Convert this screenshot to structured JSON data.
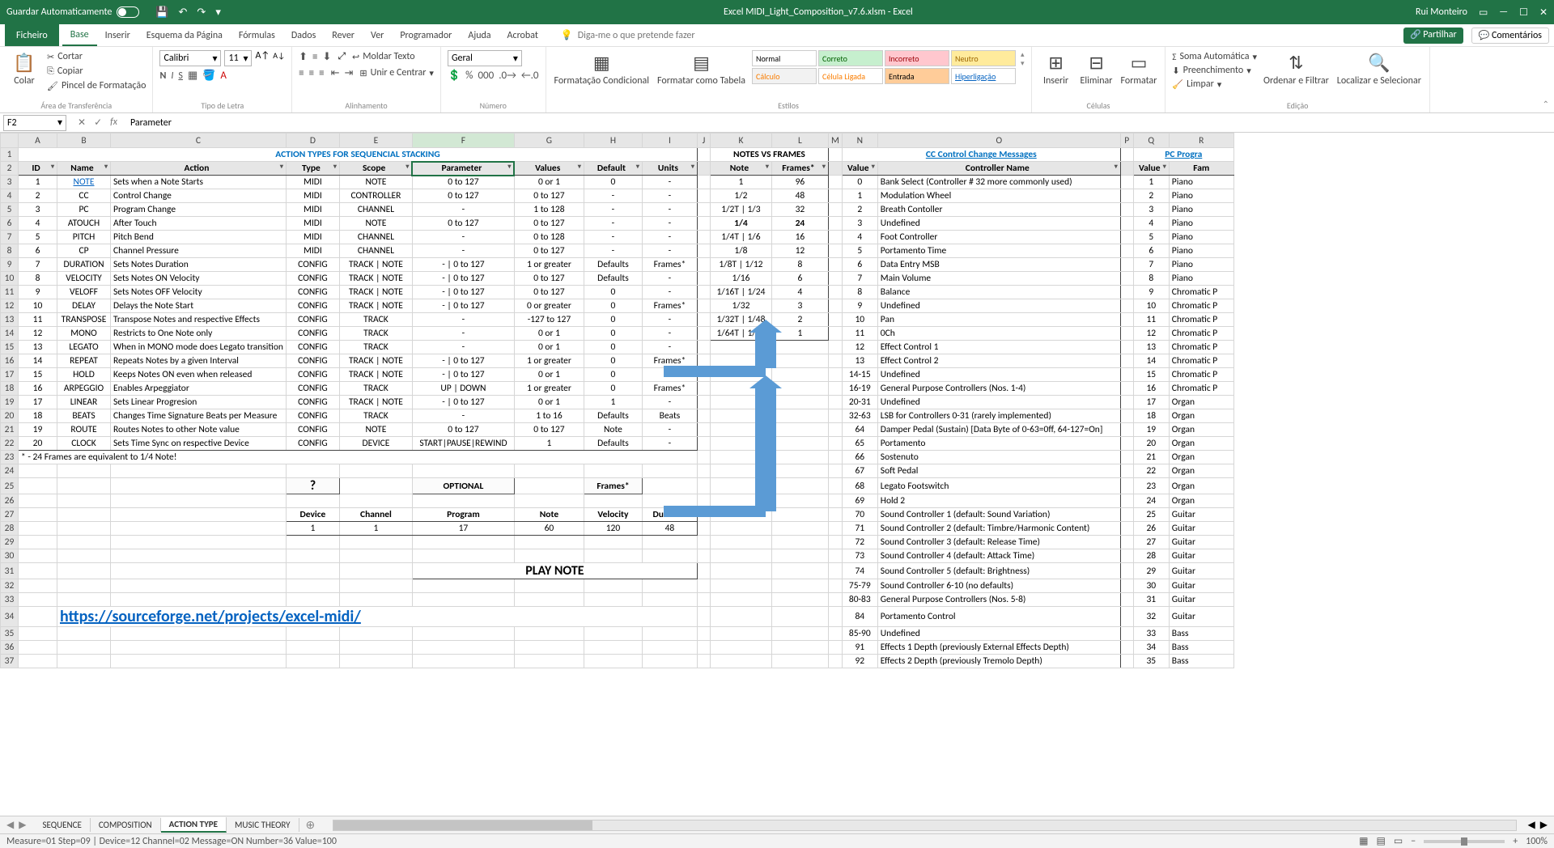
{
  "title": "Excel MIDI_Light_Composition_v7.6.xlsm - Excel",
  "user": "Rui Monteiro",
  "autosave_label": "Guardar Automaticamente",
  "tabs": {
    "file": "Ficheiro",
    "home": "Base",
    "insert": "Inserir",
    "layout": "Esquema da Página",
    "formulas": "Fórmulas",
    "data": "Dados",
    "review": "Rever",
    "view": "Ver",
    "developer": "Programador",
    "help": "Ajuda",
    "acrobat": "Acrobat"
  },
  "tellme": "Diga-me o que pretende fazer",
  "share": "Partilhar",
  "comments": "Comentários",
  "ribbon": {
    "clipboard": {
      "paste": "Colar",
      "cut": "Cortar",
      "copy": "Copiar",
      "format_painter": "Pincel de Formatação",
      "label": "Área de Transferência"
    },
    "font": {
      "name": "Calibri",
      "size": "11",
      "label": "Tipo de Letra"
    },
    "alignment": {
      "wrap": "Moldar Texto",
      "merge": "Unir e Centrar",
      "label": "Alinhamento"
    },
    "number": {
      "format": "Geral",
      "label": "Número"
    },
    "styles": {
      "normal": "Normal",
      "good": "Correto",
      "bad": "Incorreto",
      "neutral": "Neutro",
      "calc": "Cálculo",
      "linked": "Célula Ligada",
      "input": "Entrada",
      "hyper": "Hiperligação",
      "cond": "Formatação Condicional",
      "tablefmt": "Formatar como Tabela",
      "label": "Estilos"
    },
    "cells": {
      "insert": "Inserir",
      "delete": "Eliminar",
      "format": "Formatar",
      "label": "Células"
    },
    "editing": {
      "autosum": "Soma Automática",
      "fill": "Preenchimento",
      "clear": "Limpar",
      "sort": "Ordenar e Filtrar",
      "find": "Localizar e Selecionar",
      "label": "Edição"
    }
  },
  "namebox": "F2",
  "formula": "Parameter",
  "cols": [
    "A",
    "B",
    "C",
    "D",
    "E",
    "F",
    "G",
    "H",
    "I",
    "J",
    "K",
    "L",
    "M",
    "N",
    "O",
    "P",
    "Q",
    "R"
  ],
  "titles": {
    "actions": "ACTION TYPES FOR SEQUENCIAL STACKING",
    "notes": "NOTES VS FRAMES",
    "cc": "CC Control Change Messages",
    "pc": "PC Progra"
  },
  "headers": {
    "id": "ID",
    "name": "Name",
    "action": "Action",
    "type": "Type",
    "scope": "Scope",
    "parameter": "Parameter",
    "values": "Values",
    "default": "Default",
    "units": "Units",
    "note": "Note",
    "frames": "Frames*",
    "value": "Value",
    "ctrlname": "Controller Name",
    "value2": "Value",
    "family": "Fam"
  },
  "actions": [
    {
      "id": "1",
      "name": "NOTE",
      "action": "Sets when a Note Starts",
      "type": "MIDI",
      "scope": "NOTE",
      "param": "0 to 127",
      "values": "0 or 1",
      "def": "0",
      "units": "-"
    },
    {
      "id": "2",
      "name": "CC",
      "action": "Control Change",
      "type": "MIDI",
      "scope": "CONTROLLER",
      "param": "0 to 127",
      "values": "0 to 127",
      "def": "-",
      "units": "-"
    },
    {
      "id": "3",
      "name": "PC",
      "action": "Program Change",
      "type": "MIDI",
      "scope": "CHANNEL",
      "param": "-",
      "values": "1 to 128",
      "def": "-",
      "units": "-"
    },
    {
      "id": "4",
      "name": "ATOUCH",
      "action": "After Touch",
      "type": "MIDI",
      "scope": "NOTE",
      "param": "0 to 127",
      "values": "0 to 127",
      "def": "-",
      "units": "-"
    },
    {
      "id": "5",
      "name": "PITCH",
      "action": "Pitch Bend",
      "type": "MIDI",
      "scope": "CHANNEL",
      "param": "-",
      "values": "0 to 128",
      "def": "-",
      "units": "-"
    },
    {
      "id": "6",
      "name": "CP",
      "action": "Channel Pressure",
      "type": "MIDI",
      "scope": "CHANNEL",
      "param": "-",
      "values": "0 to 127",
      "def": "-",
      "units": "-"
    },
    {
      "id": "7",
      "name": "DURATION",
      "action": "Sets Notes Duration",
      "type": "CONFIG",
      "scope": "TRACK | NOTE",
      "param": "- | 0 to 127",
      "values": "1 or greater",
      "def": "Defaults",
      "units": "Frames*"
    },
    {
      "id": "8",
      "name": "VELOCITY",
      "action": "Sets Notes ON Velocity",
      "type": "CONFIG",
      "scope": "TRACK | NOTE",
      "param": "- | 0 to 127",
      "values": "0 to 127",
      "def": "Defaults",
      "units": "-"
    },
    {
      "id": "9",
      "name": "VELOFF",
      "action": "Sets Notes OFF Velocity",
      "type": "CONFIG",
      "scope": "TRACK | NOTE",
      "param": "- | 0 to 127",
      "values": "0 to 127",
      "def": "0",
      "units": "-"
    },
    {
      "id": "10",
      "name": "DELAY",
      "action": "Delays the Note Start",
      "type": "CONFIG",
      "scope": "TRACK | NOTE",
      "param": "- | 0 to 127",
      "values": "0 or greater",
      "def": "0",
      "units": "Frames*"
    },
    {
      "id": "11",
      "name": "TRANSPOSE",
      "action": "Transpose Notes and respective Effects",
      "type": "CONFIG",
      "scope": "TRACK",
      "param": "-",
      "values": "-127 to 127",
      "def": "0",
      "units": "-"
    },
    {
      "id": "12",
      "name": "MONO",
      "action": "Restricts to One Note only",
      "type": "CONFIG",
      "scope": "TRACK",
      "param": "-",
      "values": "0 or 1",
      "def": "0",
      "units": "-"
    },
    {
      "id": "13",
      "name": "LEGATO",
      "action": "When in MONO mode does Legato transition",
      "type": "CONFIG",
      "scope": "TRACK",
      "param": "-",
      "values": "0 or 1",
      "def": "0",
      "units": "-"
    },
    {
      "id": "14",
      "name": "REPEAT",
      "action": "Repeats Notes by a given Interval",
      "type": "CONFIG",
      "scope": "TRACK | NOTE",
      "param": "- | 0 to 127",
      "values": "1 or greater",
      "def": "0",
      "units": "Frames*"
    },
    {
      "id": "15",
      "name": "HOLD",
      "action": "Keeps Notes ON even when released",
      "type": "CONFIG",
      "scope": "TRACK | NOTE",
      "param": "- | 0 to 127",
      "values": "0 or 1",
      "def": "0",
      "units": "-"
    },
    {
      "id": "16",
      "name": "ARPEGGIO",
      "action": "Enables Arpeggiator",
      "type": "CONFIG",
      "scope": "TRACK",
      "param": "UP | DOWN",
      "values": "1 or greater",
      "def": "0",
      "units": "Frames*"
    },
    {
      "id": "17",
      "name": "LINEAR",
      "action": "Sets Linear Progresion",
      "type": "CONFIG",
      "scope": "TRACK | NOTE",
      "param": "- | 0 to 127",
      "values": "0 or 1",
      "def": "1",
      "units": "-"
    },
    {
      "id": "18",
      "name": "BEATS",
      "action": "Changes Time Signature Beats per Measure",
      "type": "CONFIG",
      "scope": "TRACK",
      "param": "-",
      "values": "1 to 16",
      "def": "Defaults",
      "units": "Beats"
    },
    {
      "id": "19",
      "name": "ROUTE",
      "action": "Routes Notes to other Note value",
      "type": "CONFIG",
      "scope": "NOTE",
      "param": "0 to 127",
      "values": "0 to 127",
      "def": "Note",
      "units": "-"
    },
    {
      "id": "20",
      "name": "CLOCK",
      "action": "Sets Time Sync on respective Device",
      "type": "CONFIG",
      "scope": "DEVICE",
      "param": "START|PAUSE|REWIND",
      "values": "1",
      "def": "Defaults",
      "units": "-"
    }
  ],
  "footnote": "* - 24 Frames are equivalent to 1/4 Note!",
  "notes_frames": [
    {
      "n": "1",
      "f": "96"
    },
    {
      "n": "1/2",
      "f": "48"
    },
    {
      "n": "1/2T | 1/3",
      "f": "32"
    },
    {
      "n": "1/4",
      "f": "24"
    },
    {
      "n": "1/4T | 1/6",
      "f": "16"
    },
    {
      "n": "1/8",
      "f": "12"
    },
    {
      "n": "1/8T | 1/12",
      "f": "8"
    },
    {
      "n": "1/16",
      "f": "6"
    },
    {
      "n": "1/16T | 1/24",
      "f": "4"
    },
    {
      "n": "1/32",
      "f": "3"
    },
    {
      "n": "1/32T | 1/48",
      "f": "2"
    },
    {
      "n": "1/64T | 1/96",
      "f": "1"
    }
  ],
  "cc": [
    {
      "v": "0",
      "n": "Bank Select (Controller # 32 more commonly used)"
    },
    {
      "v": "1",
      "n": "Modulation Wheel"
    },
    {
      "v": "2",
      "n": "Breath Contoller"
    },
    {
      "v": "3",
      "n": "Undefined"
    },
    {
      "v": "4",
      "n": "Foot Controller"
    },
    {
      "v": "5",
      "n": "Portamento Time"
    },
    {
      "v": "6",
      "n": "Data Entry MSB"
    },
    {
      "v": "7",
      "n": "Main Volume"
    },
    {
      "v": "8",
      "n": "Balance"
    },
    {
      "v": "9",
      "n": "Undefined"
    },
    {
      "v": "10",
      "n": "Pan"
    },
    {
      "v": "11",
      "n": "0Ch"
    },
    {
      "v": "12",
      "n": "Effect Control 1"
    },
    {
      "v": "13",
      "n": "Effect Control 2"
    },
    {
      "v": "14-15",
      "n": "Undefined"
    },
    {
      "v": "16-19",
      "n": "General Purpose Controllers (Nos. 1-4)"
    },
    {
      "v": "20-31",
      "n": "Undefined"
    },
    {
      "v": "32-63",
      "n": "LSB for Controllers 0-31 (rarely implemented)"
    },
    {
      "v": "64",
      "n": "Damper Pedal (Sustain) [Data Byte of 0-63=0ff, 64-127=On]"
    },
    {
      "v": "65",
      "n": "Portamento"
    },
    {
      "v": "66",
      "n": "Sostenuto"
    },
    {
      "v": "67",
      "n": "Soft Pedal"
    },
    {
      "v": "68",
      "n": "Legato Footswitch"
    },
    {
      "v": "69",
      "n": "Hold 2"
    },
    {
      "v": "70",
      "n": "Sound Controller 1 (default: Sound Variation)"
    },
    {
      "v": "71",
      "n": "Sound Controller 2 (default: Timbre/Harmonic Content)"
    },
    {
      "v": "72",
      "n": "Sound Controller 3 (default: Release Time)"
    },
    {
      "v": "73",
      "n": "Sound Controller 4 (default: Attack Time)"
    },
    {
      "v": "74",
      "n": "Sound Controller 5 (default: Brightness)"
    },
    {
      "v": "75-79",
      "n": "Sound Controller 6-10 (no defaults)"
    },
    {
      "v": "80-83",
      "n": "General Purpose Controllers (Nos. 5-8)"
    },
    {
      "v": "84",
      "n": "Portamento Control"
    },
    {
      "v": "85-90",
      "n": "Undefined"
    },
    {
      "v": "91",
      "n": "Effects 1 Depth (previously External Effects Depth)"
    },
    {
      "v": "92",
      "n": "Effects 2 Depth (previously Tremolo Depth)"
    }
  ],
  "pc": [
    {
      "v": "1",
      "fam": "Piano"
    },
    {
      "v": "2",
      "fam": "Piano"
    },
    {
      "v": "3",
      "fam": "Piano"
    },
    {
      "v": "4",
      "fam": "Piano"
    },
    {
      "v": "5",
      "fam": "Piano"
    },
    {
      "v": "6",
      "fam": "Piano"
    },
    {
      "v": "7",
      "fam": "Piano"
    },
    {
      "v": "8",
      "fam": "Piano"
    },
    {
      "v": "9",
      "fam": "Chromatic P"
    },
    {
      "v": "10",
      "fam": "Chromatic P"
    },
    {
      "v": "11",
      "fam": "Chromatic P"
    },
    {
      "v": "12",
      "fam": "Chromatic P"
    },
    {
      "v": "13",
      "fam": "Chromatic P"
    },
    {
      "v": "14",
      "fam": "Chromatic P"
    },
    {
      "v": "15",
      "fam": "Chromatic P"
    },
    {
      "v": "16",
      "fam": "Chromatic P"
    },
    {
      "v": "17",
      "fam": "Organ"
    },
    {
      "v": "18",
      "fam": "Organ"
    },
    {
      "v": "19",
      "fam": "Organ"
    },
    {
      "v": "20",
      "fam": "Organ"
    },
    {
      "v": "21",
      "fam": "Organ"
    },
    {
      "v": "22",
      "fam": "Organ"
    },
    {
      "v": "23",
      "fam": "Organ"
    },
    {
      "v": "24",
      "fam": "Organ"
    },
    {
      "v": "25",
      "fam": "Guitar"
    },
    {
      "v": "26",
      "fam": "Guitar"
    },
    {
      "v": "27",
      "fam": "Guitar"
    },
    {
      "v": "28",
      "fam": "Guitar"
    },
    {
      "v": "29",
      "fam": "Guitar"
    },
    {
      "v": "30",
      "fam": "Guitar"
    },
    {
      "v": "31",
      "fam": "Guitar"
    },
    {
      "v": "32",
      "fam": "Guitar"
    },
    {
      "v": "33",
      "fam": "Bass"
    },
    {
      "v": "34",
      "fam": "Bass"
    },
    {
      "v": "35",
      "fam": "Bass"
    }
  ],
  "diag": {
    "q": "?",
    "optional": "OPTIONAL",
    "frames": "Frames*",
    "device": "Device",
    "channel": "Channel",
    "program": "Program",
    "note": "Note",
    "velocity": "Velocity",
    "duration": "Duration",
    "d": "1",
    "c": "1",
    "p": "17",
    "n": "60",
    "v": "120",
    "du": "48",
    "play": "PLAY NOTE"
  },
  "link": "https://sourceforge.net/projects/excel-midi/",
  "sheets": [
    "SEQUENCE",
    "COMPOSITION",
    "ACTION TYPE",
    "MUSIC THEORY"
  ],
  "status": "Measure=01 Step=09 | Device=12 Channel=02 Message=ON  Number=36 Value=100",
  "zoom": "100%"
}
